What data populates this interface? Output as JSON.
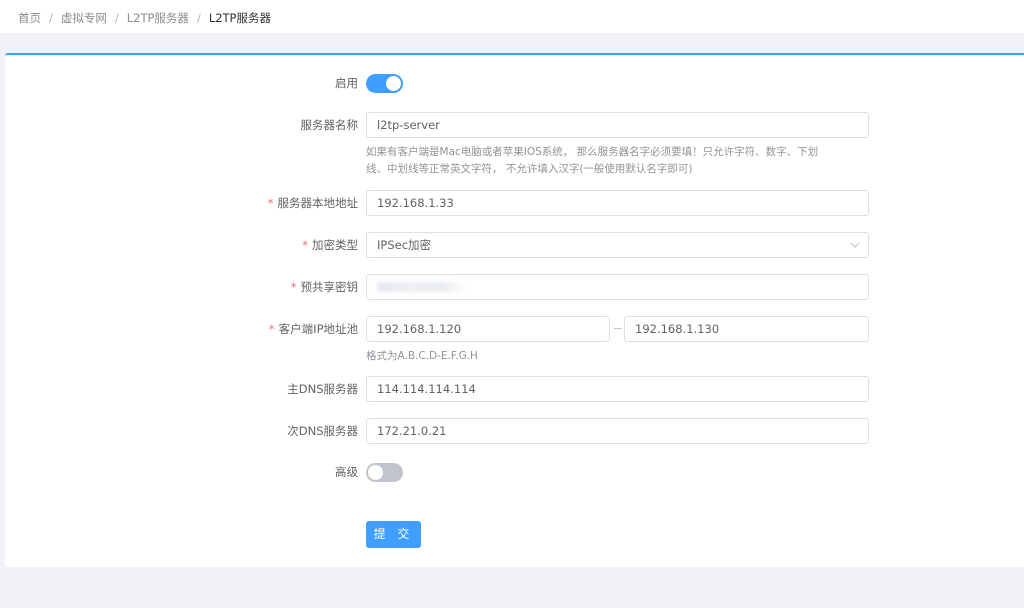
{
  "breadcrumb": [
    "首页",
    "虚拟专网",
    "L2TP服务器",
    "L2TP服务器"
  ],
  "breadcrumb_separator": "/",
  "form": {
    "enable": {
      "label": "启用",
      "value": true
    },
    "server_name": {
      "label": "服务器名称",
      "value": "l2tp-server",
      "hint_line1": "如果有客户端是Mac电脑或者苹果IOS系统， 那么服务器名字必须要填！只允许字符、数字、下划",
      "hint_line2": "线、中划线等正常英文字符， 不允许填入汉字(一般使用默认名字即可)"
    },
    "local_address": {
      "required_mark": "*",
      "label": "服务器本地地址",
      "value": "192.168.1.33"
    },
    "encryption": {
      "required_mark": "*",
      "label": "加密类型",
      "value": "IPSec加密",
      "icon": "chevron-down-icon"
    },
    "psk": {
      "required_mark": "*",
      "label": "预共享密钥",
      "value_masked": true
    },
    "ip_pool": {
      "required_mark": "*",
      "label": "客户端IP地址池",
      "start": "192.168.1.120",
      "end": "192.168.1.130",
      "hint": "格式为A.B.C.D-E.F.G.H"
    },
    "primary_dns": {
      "label": "主DNS服务器",
      "value": "114.114.114.114"
    },
    "secondary_dns": {
      "label": "次DNS服务器",
      "value": "172.21.0.21"
    },
    "advanced": {
      "label": "高级",
      "value": false
    },
    "submit_label": "提 交"
  },
  "colors": {
    "accent": "#409eff",
    "required": "#f56c6c",
    "switch_off": "#c0c4cc"
  }
}
